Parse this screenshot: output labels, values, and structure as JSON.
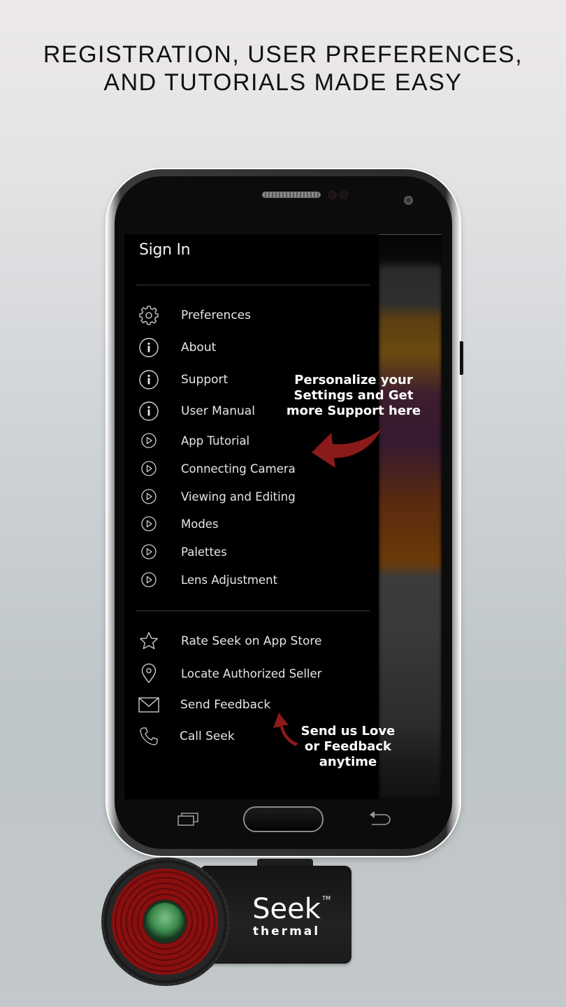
{
  "headline": {
    "line1": "REGISTRATION, USER PREFERENCES,",
    "line2": "AND TUTORIALS MADE EASY"
  },
  "drawer": {
    "sign_in": "Sign In",
    "settings_items": [
      {
        "icon": "gear-icon",
        "label": "Preferences"
      },
      {
        "icon": "info-icon",
        "label": "About"
      },
      {
        "icon": "info-icon",
        "label": "Support"
      },
      {
        "icon": "info-icon",
        "label": "User Manual"
      }
    ],
    "tutorial_items": [
      {
        "icon": "play-circle-icon",
        "label": "App Tutorial"
      },
      {
        "icon": "play-circle-icon",
        "label": "Connecting Camera"
      },
      {
        "icon": "play-circle-icon",
        "label": "Viewing and Editing"
      },
      {
        "icon": "play-circle-icon",
        "label": "Modes"
      },
      {
        "icon": "play-circle-icon",
        "label": "Palettes"
      },
      {
        "icon": "play-circle-icon",
        "label": "Lens Adjustment"
      }
    ],
    "contact_items": [
      {
        "icon": "star-icon",
        "label": "Rate Seek on App Store"
      },
      {
        "icon": "location-pin-icon",
        "label": "Locate Authorized Seller"
      },
      {
        "icon": "mail-icon",
        "label": "Send Feedback"
      },
      {
        "icon": "phone-icon",
        "label": "Call Seek"
      }
    ]
  },
  "callouts": {
    "settings": [
      "Personalize your",
      "Settings and Get",
      "more Support here"
    ],
    "feedback": [
      "Send us Love",
      "or Feedback",
      "anytime"
    ]
  },
  "navbar": {
    "recent_icon": "recent-apps-icon",
    "home_icon": "home-button",
    "back_icon": "back-icon"
  },
  "camera": {
    "brand": "Seek",
    "sub_brand": "thermal",
    "trademark": "TM"
  },
  "colors": {
    "arrow_red": "#8b1a1a",
    "lens_red": "#8a0f0f",
    "drawer_bg": "#000000",
    "text": "#e6e6e6"
  }
}
